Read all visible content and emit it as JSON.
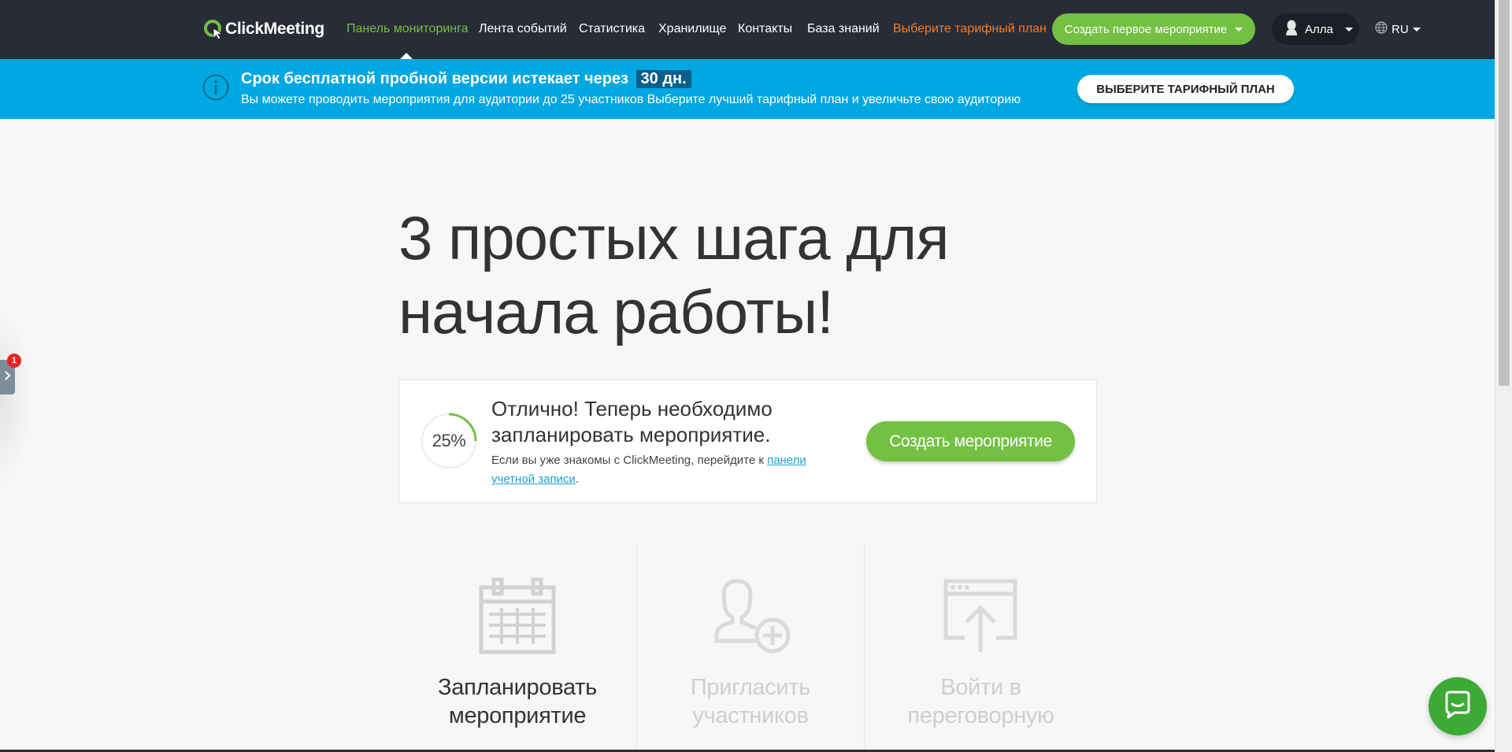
{
  "app": {
    "logo_text": "ClickMeeting"
  },
  "nav": {
    "items": [
      {
        "label": "Панель мониторинга",
        "state": "active"
      },
      {
        "label": "Лента событий"
      },
      {
        "label": "Статистика"
      },
      {
        "label": "Хранилище"
      },
      {
        "label": "Контакты"
      },
      {
        "label": "База знаний"
      },
      {
        "label": "Выберите тарифный план",
        "color": "#ff7a1a"
      }
    ],
    "create_first_label": "Создать первое мероприятие",
    "user_name": "Алла",
    "language": "RU"
  },
  "banner": {
    "title": "Срок бесплатной пробной версии истекает через",
    "days": "30 дн.",
    "subtitle": "Вы можете проводить мероприятия для аудитории до 25 участников Выберите лучший тарифный план и увеличьте свою аудиторию",
    "button": "ВЫБЕРИТЕ ТАРИФНЫЙ ПЛАН"
  },
  "hero": {
    "line1": "3 простых шага для",
    "line2": "начала работы!"
  },
  "step_card": {
    "progress": 25,
    "progress_label": "25%",
    "title": "Отлично! Теперь необходимо запланировать мероприятие.",
    "text_before": "Если вы уже знакомы с ClickMeeting, перейдите к ",
    "link": "панели учетной записи",
    "text_after": ".",
    "button": "Создать мероприятие"
  },
  "steps": [
    {
      "line1": "Запланировать",
      "line2": "мероприятие",
      "icon": "calendar-icon",
      "state": "active"
    },
    {
      "line1": "Пригласить",
      "line2": "участников",
      "icon": "add-user-icon",
      "state": "inactive"
    },
    {
      "line1": "Войти в",
      "line2": "переговорную",
      "icon": "upload-window-icon",
      "state": "inactive"
    }
  ],
  "side_tab": {
    "badge": "1"
  },
  "colors": {
    "brand_green": "#74c043",
    "navbar": "#272c36",
    "banner_blue": "#00a7e1",
    "accent_orange": "#ff7a1a",
    "link_blue": "#1f9fd8"
  }
}
